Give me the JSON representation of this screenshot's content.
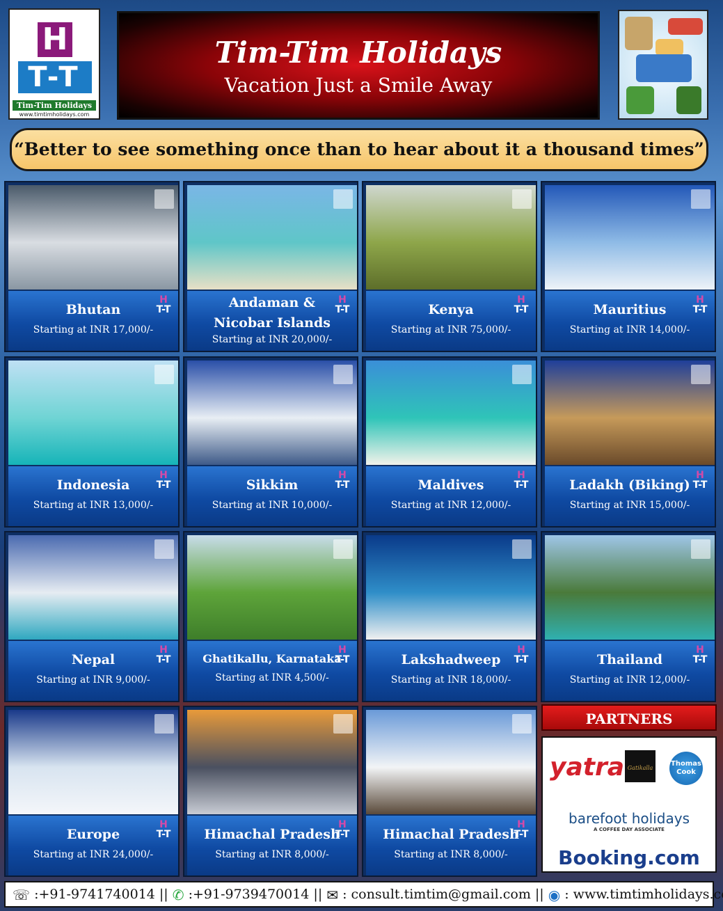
{
  "header": {
    "logo_left": {
      "letter_h": "H",
      "letters_tt": "T-T",
      "name": "Tim-Tim Holidays",
      "url": "www.timtimholidays.com"
    },
    "title": "Tim-Tim Holidays",
    "tagline": "Vacation Just a Smile Away"
  },
  "quote": "“Better to see something once than to hear about it a thousand times”",
  "badge": {
    "h": "H",
    "tt": "T-T"
  },
  "destinations": [
    {
      "name": "Bhutan",
      "price": "Starting at INR 17,000/-",
      "colors": [
        "#4a5a6a",
        "#d9dde2",
        "#8a97a3"
      ]
    },
    {
      "name_line1": "Andaman &",
      "name_line2": "Nicobar Islands",
      "price": "Starting at INR 20,000/-",
      "colors": [
        "#7ab6e6",
        "#5fc6c8",
        "#e8e0c6"
      ]
    },
    {
      "name": "Kenya",
      "price": "Starting at INR 75,000/-",
      "colors": [
        "#cfd7cf",
        "#8ea64a",
        "#5d6e2a"
      ]
    },
    {
      "name": "Mauritius",
      "price": "Starting at INR 14,000/-",
      "colors": [
        "#2358b8",
        "#8fbbe6",
        "#eef3f8"
      ]
    },
    {
      "name": "Indonesia",
      "price": "Starting at INR 13,000/-",
      "colors": [
        "#bfe0f4",
        "#6fd4d4",
        "#16b4b8"
      ]
    },
    {
      "name": "Sikkim",
      "price": "Starting at INR 10,000/-",
      "colors": [
        "#2a4fa8",
        "#e8eef4",
        "#3e5a88"
      ]
    },
    {
      "name": "Maldives",
      "price": "Starting at INR 12,000/-",
      "colors": [
        "#3a8fd8",
        "#2fc4b8",
        "#f2f2ea"
      ]
    },
    {
      "name": "Ladakh (Biking)",
      "price": "Starting at INR 15,000/-",
      "colors": [
        "#1f3f9a",
        "#c69a5a",
        "#6a4a2a"
      ]
    },
    {
      "name": "Nepal",
      "price": "Starting at INR 9,000/-",
      "colors": [
        "#4a6ab0",
        "#e6ecf2",
        "#2fa8c0"
      ]
    },
    {
      "name": "Ghatikallu, Karnataka",
      "price": "Starting at INR 4,500/-",
      "colors": [
        "#c8dcea",
        "#5ea43a",
        "#3e7e2a"
      ]
    },
    {
      "name": "Lakshadweep",
      "price": "Starting at INR 18,000/-",
      "colors": [
        "#0a3a8a",
        "#2f8ec8",
        "#f0f0f0"
      ]
    },
    {
      "name": "Thailand",
      "price": "Starting at INR 12,000/-",
      "colors": [
        "#9fc6e8",
        "#4a7a3a",
        "#2fb0b0"
      ]
    },
    {
      "name": "Europe",
      "price": "Starting at INR 24,000/-",
      "colors": [
        "#1a3a8a",
        "#d8e4f0",
        "#f4f6fa"
      ]
    },
    {
      "name": "Himachal Pradesh",
      "price": "Starting at INR 8,000/-",
      "colors": [
        "#e89a3a",
        "#4a5060",
        "#c8ccd4"
      ]
    },
    {
      "name": "Himachal Pradesh",
      "price": "Starting at INR 8,000/-",
      "colors": [
        "#6a9ad8",
        "#f2f4f6",
        "#5a4a3a"
      ]
    }
  ],
  "partners": {
    "heading": "PARTNERS",
    "yatra": "yatra",
    "gateway": "Gatikalla",
    "thomas_cook": "Thomas Cook",
    "barefoot": "barefoot holidays",
    "barefoot_sub": "A COFFEE DAY ASSOCIATE",
    "booking": "Booking.com"
  },
  "footer": {
    "phone": ":+91-9741740014 ||",
    "whatsapp": ":+91-9739470014 ||",
    "email": ": consult.timtim@gmail.com ||",
    "website": ": www.timtimholidays.com"
  }
}
